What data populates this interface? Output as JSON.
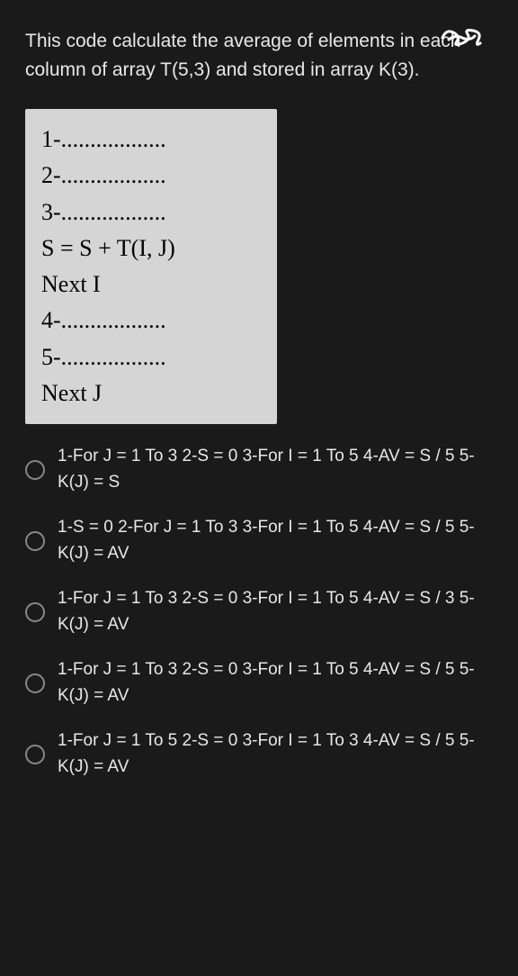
{
  "question": "This code calculate the average of elements  in each column of array T(5,3) and stored in array K(3).",
  "code": {
    "line1": "1-..................",
    "line2": "2-..................",
    "line3": "3-..................",
    "line4": "S = S + T(I, J)",
    "line5": "Next I",
    "line6": "4-..................",
    "line7": "5-..................",
    "line8": "Next J"
  },
  "options": [
    "1-For J = 1 To 3 2-S = 0 3-For I = 1 To 5 4-AV = S / 5 5-K(J) = S",
    "1-S = 0 2-For J = 1 To 3 3-For I = 1 To 5 4-AV = S / 5 5-K(J) = AV",
    "1-For J = 1 To 3 2-S = 0 3-For I = 1 To 5 4-AV = S / 3 5-K(J) = AV",
    "1-For J = 1 To 3 2-S = 0 3-For I = 1 To 5 4-AV = S / 5 5-K(J) = AV",
    "1-For J = 1 To 5 2-S = 0 3-For I = 1 To 3 4-AV = S / 5 5-K(J) = AV"
  ]
}
